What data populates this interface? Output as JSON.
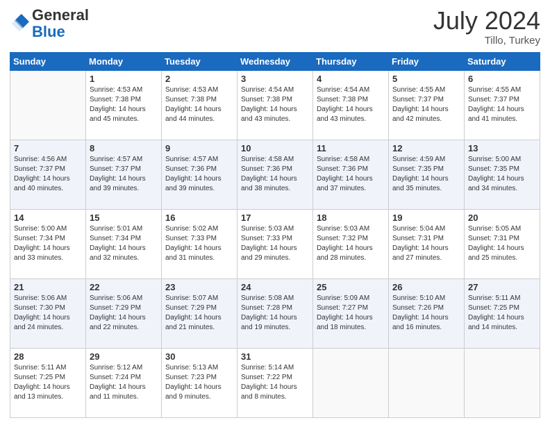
{
  "header": {
    "logo_general": "General",
    "logo_blue": "Blue",
    "month": "July 2024",
    "location": "Tillo, Turkey"
  },
  "columns": [
    "Sunday",
    "Monday",
    "Tuesday",
    "Wednesday",
    "Thursday",
    "Friday",
    "Saturday"
  ],
  "weeks": [
    [
      {
        "day": "",
        "info": ""
      },
      {
        "day": "1",
        "info": "Sunrise: 4:53 AM\nSunset: 7:38 PM\nDaylight: 14 hours\nand 45 minutes."
      },
      {
        "day": "2",
        "info": "Sunrise: 4:53 AM\nSunset: 7:38 PM\nDaylight: 14 hours\nand 44 minutes."
      },
      {
        "day": "3",
        "info": "Sunrise: 4:54 AM\nSunset: 7:38 PM\nDaylight: 14 hours\nand 43 minutes."
      },
      {
        "day": "4",
        "info": "Sunrise: 4:54 AM\nSunset: 7:38 PM\nDaylight: 14 hours\nand 43 minutes."
      },
      {
        "day": "5",
        "info": "Sunrise: 4:55 AM\nSunset: 7:37 PM\nDaylight: 14 hours\nand 42 minutes."
      },
      {
        "day": "6",
        "info": "Sunrise: 4:55 AM\nSunset: 7:37 PM\nDaylight: 14 hours\nand 41 minutes."
      }
    ],
    [
      {
        "day": "7",
        "info": "Sunrise: 4:56 AM\nSunset: 7:37 PM\nDaylight: 14 hours\nand 40 minutes."
      },
      {
        "day": "8",
        "info": "Sunrise: 4:57 AM\nSunset: 7:37 PM\nDaylight: 14 hours\nand 39 minutes."
      },
      {
        "day": "9",
        "info": "Sunrise: 4:57 AM\nSunset: 7:36 PM\nDaylight: 14 hours\nand 39 minutes."
      },
      {
        "day": "10",
        "info": "Sunrise: 4:58 AM\nSunset: 7:36 PM\nDaylight: 14 hours\nand 38 minutes."
      },
      {
        "day": "11",
        "info": "Sunrise: 4:58 AM\nSunset: 7:36 PM\nDaylight: 14 hours\nand 37 minutes."
      },
      {
        "day": "12",
        "info": "Sunrise: 4:59 AM\nSunset: 7:35 PM\nDaylight: 14 hours\nand 35 minutes."
      },
      {
        "day": "13",
        "info": "Sunrise: 5:00 AM\nSunset: 7:35 PM\nDaylight: 14 hours\nand 34 minutes."
      }
    ],
    [
      {
        "day": "14",
        "info": "Sunrise: 5:00 AM\nSunset: 7:34 PM\nDaylight: 14 hours\nand 33 minutes."
      },
      {
        "day": "15",
        "info": "Sunrise: 5:01 AM\nSunset: 7:34 PM\nDaylight: 14 hours\nand 32 minutes."
      },
      {
        "day": "16",
        "info": "Sunrise: 5:02 AM\nSunset: 7:33 PM\nDaylight: 14 hours\nand 31 minutes."
      },
      {
        "day": "17",
        "info": "Sunrise: 5:03 AM\nSunset: 7:33 PM\nDaylight: 14 hours\nand 29 minutes."
      },
      {
        "day": "18",
        "info": "Sunrise: 5:03 AM\nSunset: 7:32 PM\nDaylight: 14 hours\nand 28 minutes."
      },
      {
        "day": "19",
        "info": "Sunrise: 5:04 AM\nSunset: 7:31 PM\nDaylight: 14 hours\nand 27 minutes."
      },
      {
        "day": "20",
        "info": "Sunrise: 5:05 AM\nSunset: 7:31 PM\nDaylight: 14 hours\nand 25 minutes."
      }
    ],
    [
      {
        "day": "21",
        "info": "Sunrise: 5:06 AM\nSunset: 7:30 PM\nDaylight: 14 hours\nand 24 minutes."
      },
      {
        "day": "22",
        "info": "Sunrise: 5:06 AM\nSunset: 7:29 PM\nDaylight: 14 hours\nand 22 minutes."
      },
      {
        "day": "23",
        "info": "Sunrise: 5:07 AM\nSunset: 7:29 PM\nDaylight: 14 hours\nand 21 minutes."
      },
      {
        "day": "24",
        "info": "Sunrise: 5:08 AM\nSunset: 7:28 PM\nDaylight: 14 hours\nand 19 minutes."
      },
      {
        "day": "25",
        "info": "Sunrise: 5:09 AM\nSunset: 7:27 PM\nDaylight: 14 hours\nand 18 minutes."
      },
      {
        "day": "26",
        "info": "Sunrise: 5:10 AM\nSunset: 7:26 PM\nDaylight: 14 hours\nand 16 minutes."
      },
      {
        "day": "27",
        "info": "Sunrise: 5:11 AM\nSunset: 7:25 PM\nDaylight: 14 hours\nand 14 minutes."
      }
    ],
    [
      {
        "day": "28",
        "info": "Sunrise: 5:11 AM\nSunset: 7:25 PM\nDaylight: 14 hours\nand 13 minutes."
      },
      {
        "day": "29",
        "info": "Sunrise: 5:12 AM\nSunset: 7:24 PM\nDaylight: 14 hours\nand 11 minutes."
      },
      {
        "day": "30",
        "info": "Sunrise: 5:13 AM\nSunset: 7:23 PM\nDaylight: 14 hours\nand 9 minutes."
      },
      {
        "day": "31",
        "info": "Sunrise: 5:14 AM\nSunset: 7:22 PM\nDaylight: 14 hours\nand 8 minutes."
      },
      {
        "day": "",
        "info": ""
      },
      {
        "day": "",
        "info": ""
      },
      {
        "day": "",
        "info": ""
      }
    ]
  ]
}
